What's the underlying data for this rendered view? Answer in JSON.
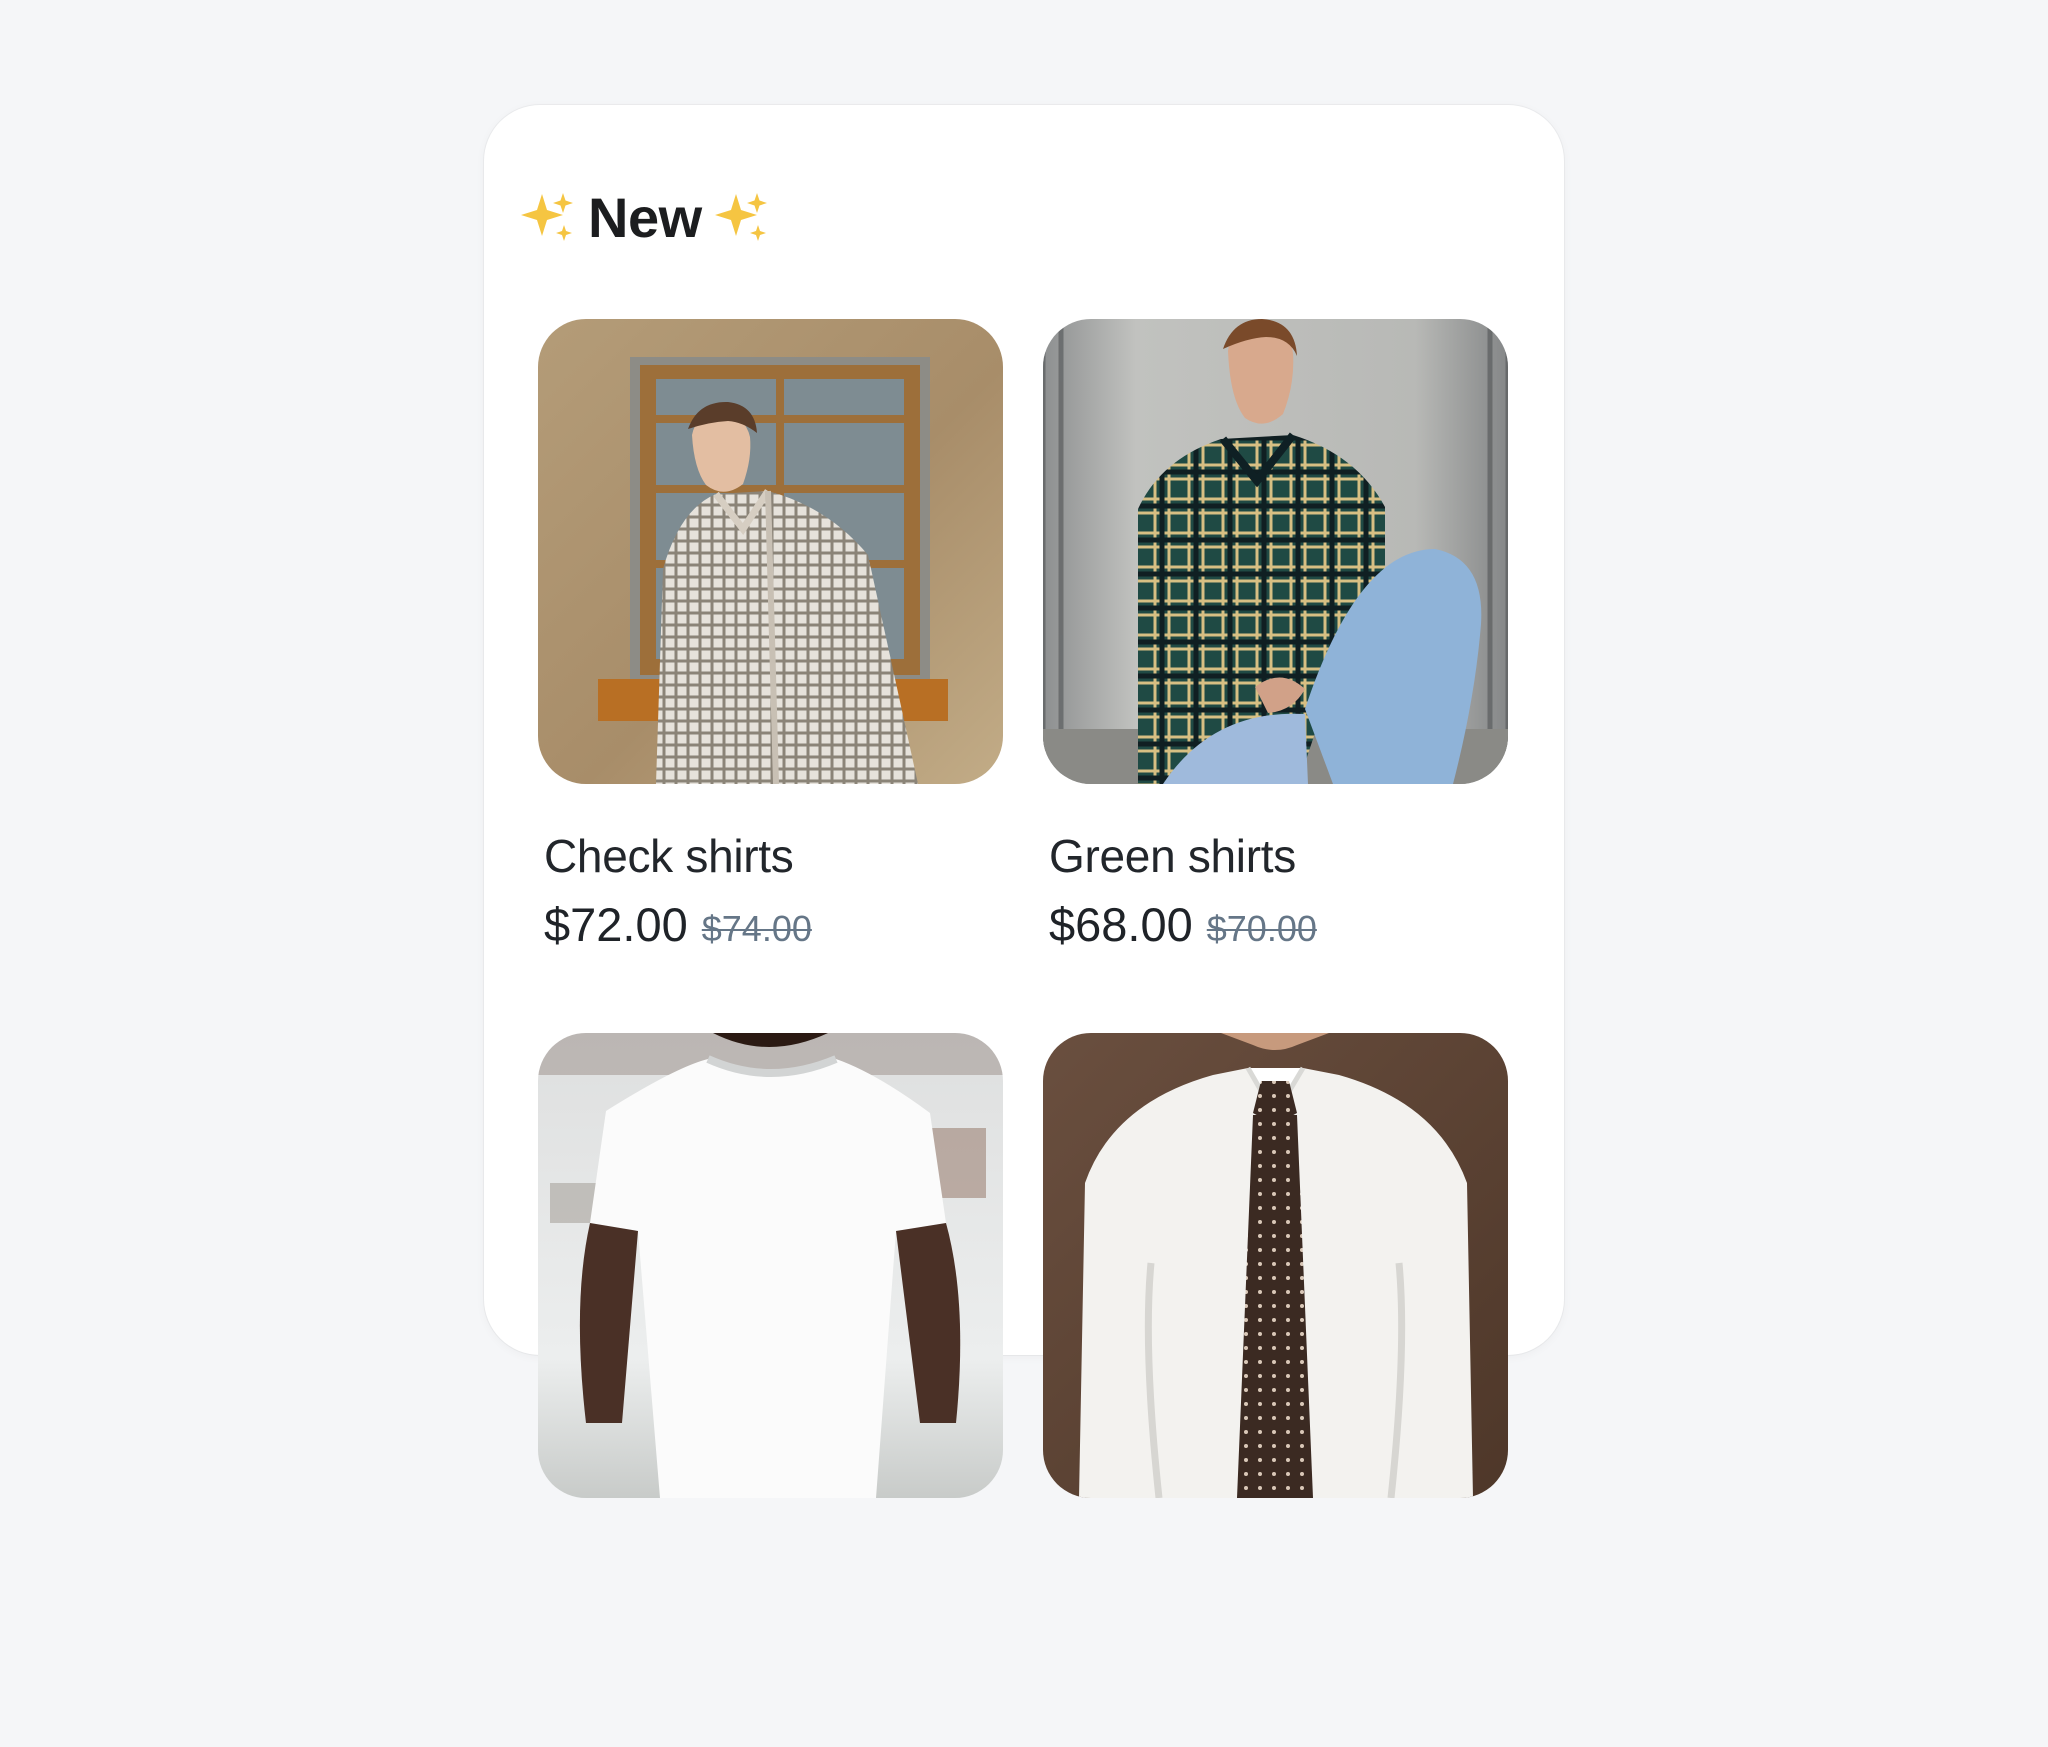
{
  "section": {
    "title": "New",
    "icon_left": "sparkles-icon",
    "icon_right": "sparkles-icon",
    "accent_color": "#f5c542"
  },
  "products": [
    {
      "name": "Check shirts",
      "price": "$72.00",
      "old_price": "$74.00",
      "image_icon": "man-check-shirt-photo"
    },
    {
      "name": "Green shirts",
      "price": "$68.00",
      "old_price": "$70.00",
      "image_icon": "man-green-plaid-shirt-photo"
    },
    {
      "image_icon": "white-tshirt-photo"
    },
    {
      "image_icon": "white-dress-shirt-tie-photo"
    }
  ]
}
